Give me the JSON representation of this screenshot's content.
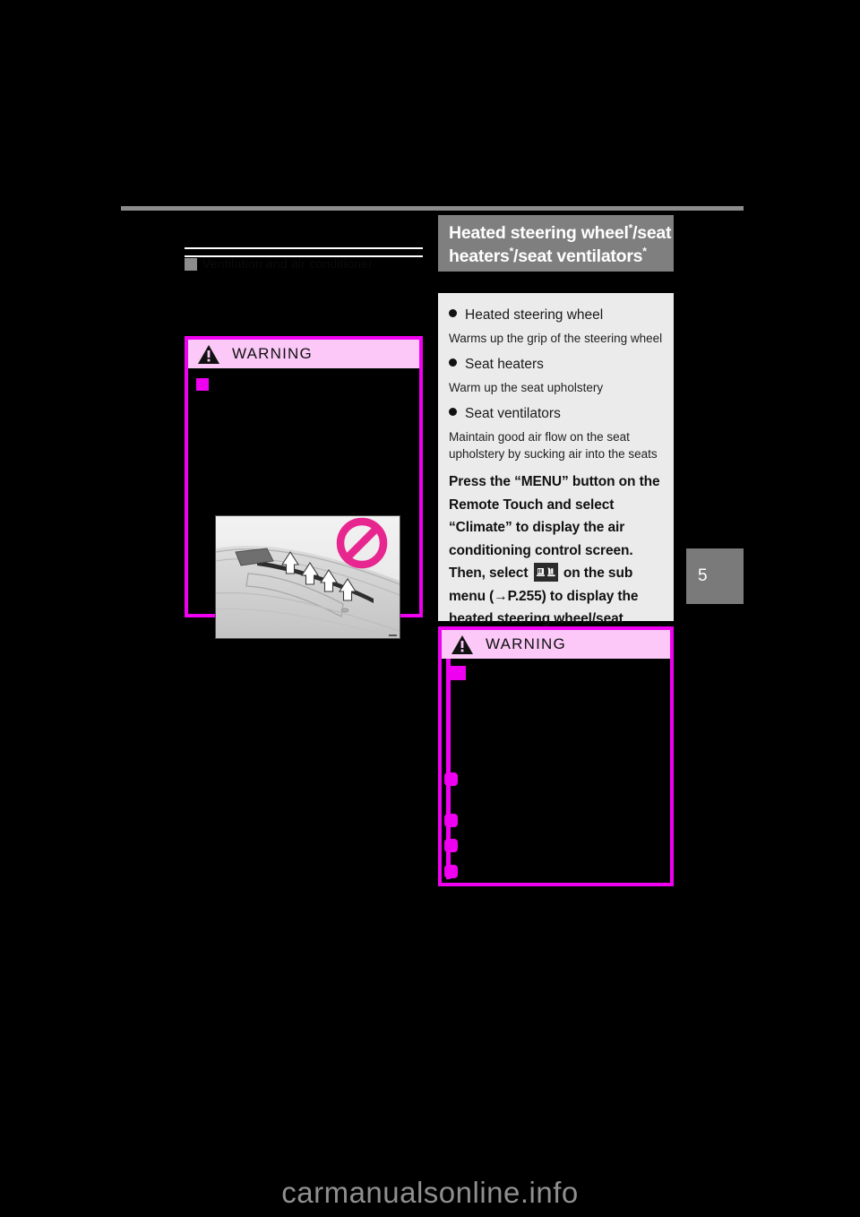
{
  "page": {
    "background_color": "#000000",
    "chapter_number": "5",
    "watermark": "carmanualsonline.info"
  },
  "left_column": {
    "redacted_heading": {
      "marker_icon": "square-marker-icon",
      "ghost_text": "Ventilation and air conditioner"
    },
    "warning": {
      "label": "WARNING",
      "icon": "warning-triangle-icon",
      "illustration": {
        "name": "dashboard-air-outlet-illustration",
        "prohibition_icon": "prohibition-icon"
      }
    }
  },
  "right_column": {
    "section_title": {
      "line1": "Heated steering wheel",
      "line1_sup": "*",
      "line1_tail": "/seat",
      "line2": "heaters",
      "line2_sup": "*",
      "line2_tail": "/seat ventilators",
      "line2_sup2": "*",
      "background_color": "#7f7f7f"
    },
    "features": [
      {
        "name": "Heated steering wheel",
        "description": "Warms up the grip of the steering wheel"
      },
      {
        "name": "Seat heaters",
        "description": "Warm up the seat upholstery"
      },
      {
        "name": "Seat ventilators",
        "description": "Maintain good air flow on the seat upholstery by sucking air into the seats"
      }
    ],
    "procedure": {
      "part1": "Press the “MENU” button on the Remote Touch and select “Climate” to display the air conditioning control screen. Then, select",
      "icon": "seat-heater-ventilator-icon",
      "part2": "on the sub menu (→P.255) to display the heated steering wheel/seat heaters/seat ventilators control screen."
    },
    "warning": {
      "label": "WARNING",
      "icon": "warning-triangle-icon",
      "bullet_count": 4
    }
  },
  "colors": {
    "warning_border": "#f000f0",
    "warning_header_bg": "#fbc8f7",
    "panel_bg": "#ebebeb",
    "title_bg": "#7f7f7f",
    "rule": "#8c8c8c",
    "tab_bg": "#7a7a7a"
  }
}
